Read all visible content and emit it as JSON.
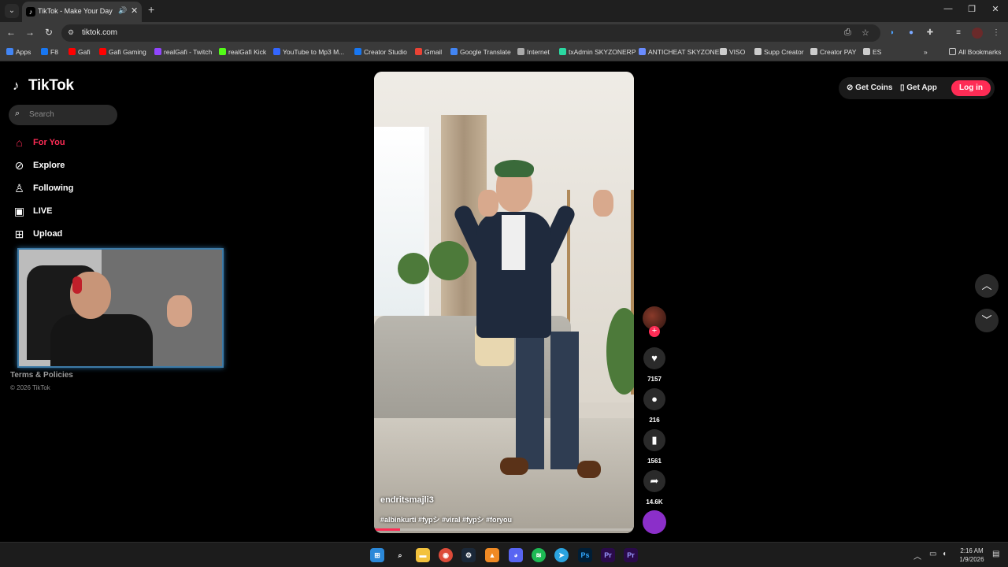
{
  "browser": {
    "tab_title": "TikTok - Make Your Day",
    "url": "tiktok.com",
    "bookmarks": [
      {
        "label": "Apps",
        "color": "#4285f4"
      },
      {
        "label": "F8",
        "color": "#1877f2"
      },
      {
        "label": "Gafi",
        "color": "#ff0000"
      },
      {
        "label": "Gafi Gaming",
        "color": "#ff0000"
      },
      {
        "label": "realGafi - Twitch",
        "color": "#9146ff"
      },
      {
        "label": "realGafi Kick",
        "color": "#53fc18"
      },
      {
        "label": "YouTube to Mp3 M...",
        "color": "#3366ff"
      },
      {
        "label": "Creator Studio",
        "color": "#1877f2"
      },
      {
        "label": "Gmail",
        "color": "#ea4335"
      },
      {
        "label": "Google Translate",
        "color": "#4285f4"
      },
      {
        "label": "Internet",
        "color": "#aaaaaa"
      },
      {
        "label": "txAdmin SKYZONERP",
        "color": "#2bd9a2"
      },
      {
        "label": "ANTICHEAT SKYZONE",
        "color": "#6a8cff"
      },
      {
        "label": "VISO",
        "color": "#cccccc"
      },
      {
        "label": "Supp Creator",
        "color": "#cccccc"
      },
      {
        "label": "Creator PAY",
        "color": "#cccccc"
      },
      {
        "label": "ES",
        "color": "#cccccc"
      }
    ],
    "all_bookmarks": "All Bookmarks"
  },
  "tiktok": {
    "logo": "TikTok",
    "search_placeholder": "Search",
    "nav": [
      {
        "label": "For You",
        "icon": "home-icon"
      },
      {
        "label": "Explore",
        "icon": "compass-icon"
      },
      {
        "label": "Following",
        "icon": "following-icon"
      },
      {
        "label": "LIVE",
        "icon": "live-icon"
      },
      {
        "label": "Upload",
        "icon": "upload-icon"
      }
    ],
    "footer": {
      "terms": "Terms & Policies",
      "copyright": "© 2026 TikTok"
    },
    "top": {
      "get_coins": "Get Coins",
      "get_app": "Get App",
      "login": "Log in"
    },
    "video": {
      "username": "endritsmajli3",
      "caption": "#albinkurti #fypシ #viral #fypシ #foryou",
      "progress": 0.1
    },
    "actions": {
      "likes": "7157",
      "comments": "216",
      "saves": "1561",
      "shares": "14.6K"
    }
  },
  "taskbar": {
    "time": "2:16 AM",
    "date": "1/9/2026",
    "apps": [
      {
        "label": "",
        "icon": "windows-icon",
        "color": "#2b88d8"
      },
      {
        "label": "",
        "icon": "search-icon",
        "color": "#1c1c1c"
      },
      {
        "label": "",
        "icon": "file-explorer-icon",
        "color": "#f3c23d"
      },
      {
        "label": "",
        "icon": "chrome-icon",
        "color": "#dd4b39"
      },
      {
        "label": "",
        "icon": "steam-icon",
        "color": "#1b2838"
      },
      {
        "label": "",
        "icon": "vlc-icon",
        "color": "#f08a24"
      },
      {
        "label": "",
        "icon": "discord-icon",
        "color": "#5865f2"
      },
      {
        "label": "",
        "icon": "spotify-icon",
        "color": "#1db954"
      },
      {
        "label": "",
        "icon": "telegram-icon",
        "color": "#2aa3df"
      },
      {
        "label": "Ps",
        "icon": "photoshop-icon",
        "color": "#001e36"
      },
      {
        "label": "Pr",
        "icon": "premiere-icon",
        "color": "#2a0a4a"
      },
      {
        "label": "Pr",
        "icon": "premiere-icon",
        "color": "#2a0a4a"
      }
    ]
  }
}
